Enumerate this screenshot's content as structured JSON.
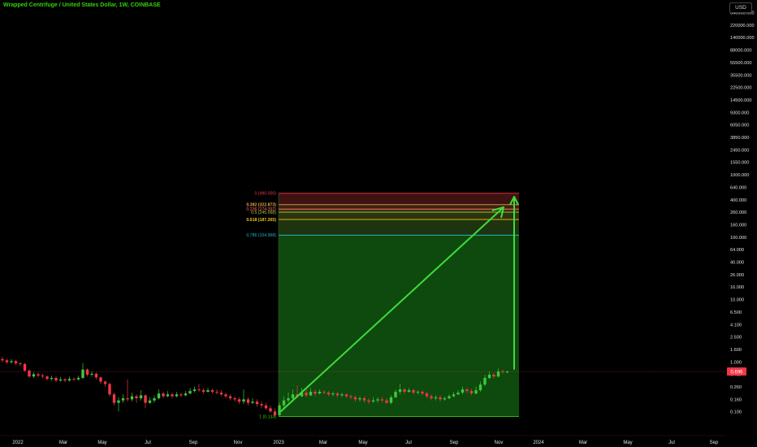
{
  "header": {
    "title": "Wrapped Centrifuge / United States Dollar, 1W, COINBASE",
    "currency": "USD"
  },
  "colors": {
    "background": "#000000",
    "title": "#35d10a",
    "up_candle": "#3ec93a",
    "down_candle": "#f23645",
    "axis_text": "#e0e0e0",
    "price_line": "#f23645",
    "arrow": "#3ddc3d",
    "target_zone": "#0f4d0f"
  },
  "chart_data": {
    "type": "candlestick",
    "title": "Wrapped Centrifuge / United States Dollar, 1W, COINBASE",
    "y_scale": "log",
    "y_ticks": [
      "340000.000",
      "220000.000",
      "140000.000",
      "88000.000",
      "55500.000",
      "35500.000",
      "22500.000",
      "14500.000",
      "9300.000",
      "6050.000",
      "3850.000",
      "2450.000",
      "1550.000",
      "1000.000",
      "640.000",
      "400.000",
      "260.000",
      "160.000",
      "100.000",
      "64.000",
      "40.000",
      "26.000",
      "16.000",
      "10.000",
      "6.500",
      "4.100",
      "2.500",
      "1.600",
      "1.000",
      "0.410",
      "0.260",
      "0.160",
      "0.100"
    ],
    "x_ticks": [
      "2022",
      "Mar",
      "May",
      "Jul",
      "Sep",
      "Nov",
      "2023",
      "Mar",
      "May",
      "Jul",
      "Sep",
      "Nov",
      "2024",
      "Mar",
      "May",
      "Jul",
      "Sep"
    ],
    "last_price": {
      "label": "0.696",
      "value": 0.696
    },
    "fib_levels": [
      {
        "ratio": "0",
        "label": "0 (490.000)",
        "value": 490.0,
        "color": "#f23645"
      },
      {
        "ratio": "0.236",
        "label": "0.236 (274.392)",
        "value": 274.392,
        "color": "#ff6b6b"
      },
      {
        "ratio": "0.382",
        "label": "0.382 (322.873)",
        "value": 322.873,
        "color": "#e8a33d"
      },
      {
        "ratio": "0.5",
        "label": "0.5 (245.068)",
        "value": 245.068,
        "color": "#a8c93a"
      },
      {
        "ratio": "0.618",
        "label": "0.618 (187.265)",
        "value": 187.265,
        "color": "#f0c419"
      },
      {
        "ratio": "0.786",
        "label": "0.786 (104.968)",
        "value": 104.968,
        "color": "#22b5c9"
      },
      {
        "ratio": "1",
        "label": "1 (0.133)",
        "value": 0.133,
        "color": "#35d10a"
      }
    ],
    "candles": [
      [
        1.1,
        1.05,
        1.2,
        0.98
      ],
      [
        1.05,
        0.98,
        1.12,
        0.92
      ],
      [
        0.98,
        1.02,
        1.1,
        0.93
      ],
      [
        1.02,
        0.94,
        1.06,
        0.88
      ],
      [
        0.94,
        0.92,
        0.99,
        0.85
      ],
      [
        0.92,
        0.72,
        0.95,
        0.68
      ],
      [
        0.72,
        0.58,
        0.75,
        0.55
      ],
      [
        0.58,
        0.63,
        0.68,
        0.55
      ],
      [
        0.63,
        0.6,
        0.67,
        0.56
      ],
      [
        0.6,
        0.58,
        0.64,
        0.54
      ],
      [
        0.58,
        0.53,
        0.6,
        0.5
      ],
      [
        0.53,
        0.55,
        0.6,
        0.5
      ],
      [
        0.55,
        0.5,
        0.58,
        0.47
      ],
      [
        0.5,
        0.52,
        0.57,
        0.48
      ],
      [
        0.52,
        0.5,
        0.55,
        0.47
      ],
      [
        0.5,
        0.53,
        0.58,
        0.48
      ],
      [
        0.53,
        0.52,
        0.56,
        0.49
      ],
      [
        0.52,
        0.55,
        0.6,
        0.5
      ],
      [
        0.55,
        0.75,
        0.95,
        0.53
      ],
      [
        0.75,
        0.62,
        0.78,
        0.58
      ],
      [
        0.62,
        0.64,
        0.7,
        0.58
      ],
      [
        0.64,
        0.56,
        0.67,
        0.52
      ],
      [
        0.56,
        0.48,
        0.58,
        0.44
      ],
      [
        0.48,
        0.44,
        0.5,
        0.4
      ],
      [
        0.44,
        0.3,
        0.46,
        0.28
      ],
      [
        0.3,
        0.22,
        0.32,
        0.2
      ],
      [
        0.22,
        0.24,
        0.27,
        0.16
      ],
      [
        0.24,
        0.26,
        0.3,
        0.22
      ],
      [
        0.26,
        0.25,
        0.52,
        0.23
      ],
      [
        0.25,
        0.28,
        0.32,
        0.23
      ],
      [
        0.28,
        0.26,
        0.3,
        0.22
      ],
      [
        0.26,
        0.29,
        0.35,
        0.24
      ],
      [
        0.29,
        0.22,
        0.3,
        0.18
      ],
      [
        0.22,
        0.24,
        0.27,
        0.21
      ],
      [
        0.24,
        0.26,
        0.29,
        0.22
      ],
      [
        0.26,
        0.31,
        0.36,
        0.25
      ],
      [
        0.31,
        0.28,
        0.33,
        0.26
      ],
      [
        0.28,
        0.3,
        0.34,
        0.27
      ],
      [
        0.3,
        0.28,
        0.32,
        0.26
      ],
      [
        0.28,
        0.3,
        0.33,
        0.27
      ],
      [
        0.3,
        0.29,
        0.32,
        0.27
      ],
      [
        0.29,
        0.31,
        0.34,
        0.28
      ],
      [
        0.31,
        0.34,
        0.38,
        0.3
      ],
      [
        0.34,
        0.36,
        0.4,
        0.32
      ],
      [
        0.36,
        0.35,
        0.44,
        0.33
      ],
      [
        0.35,
        0.33,
        0.38,
        0.31
      ],
      [
        0.33,
        0.35,
        0.38,
        0.32
      ],
      [
        0.35,
        0.33,
        0.37,
        0.31
      ],
      [
        0.33,
        0.32,
        0.36,
        0.3
      ],
      [
        0.32,
        0.3,
        0.35,
        0.28
      ],
      [
        0.3,
        0.28,
        0.32,
        0.26
      ],
      [
        0.28,
        0.26,
        0.3,
        0.24
      ],
      [
        0.26,
        0.25,
        0.28,
        0.23
      ],
      [
        0.25,
        0.23,
        0.27,
        0.21
      ],
      [
        0.23,
        0.25,
        0.36,
        0.21
      ],
      [
        0.25,
        0.22,
        0.27,
        0.2
      ],
      [
        0.22,
        0.23,
        0.26,
        0.21
      ],
      [
        0.23,
        0.21,
        0.25,
        0.19
      ],
      [
        0.21,
        0.2,
        0.23,
        0.18
      ],
      [
        0.2,
        0.18,
        0.22,
        0.17
      ],
      [
        0.18,
        0.16,
        0.2,
        0.15
      ],
      [
        0.16,
        0.14,
        0.18,
        0.133
      ],
      [
        0.14,
        0.2,
        0.22,
        0.135
      ],
      [
        0.2,
        0.24,
        0.28,
        0.18
      ],
      [
        0.24,
        0.26,
        0.32,
        0.22
      ],
      [
        0.26,
        0.3,
        0.36,
        0.24
      ],
      [
        0.3,
        0.28,
        0.42,
        0.26
      ],
      [
        0.28,
        0.32,
        0.38,
        0.27
      ],
      [
        0.32,
        0.29,
        0.36,
        0.27
      ],
      [
        0.29,
        0.33,
        0.38,
        0.28
      ],
      [
        0.33,
        0.31,
        0.36,
        0.28
      ],
      [
        0.31,
        0.33,
        0.36,
        0.3
      ],
      [
        0.33,
        0.32,
        0.35,
        0.3
      ],
      [
        0.32,
        0.3,
        0.34,
        0.28
      ],
      [
        0.3,
        0.31,
        0.33,
        0.28
      ],
      [
        0.31,
        0.29,
        0.33,
        0.27
      ],
      [
        0.29,
        0.3,
        0.32,
        0.27
      ],
      [
        0.3,
        0.28,
        0.31,
        0.26
      ],
      [
        0.28,
        0.27,
        0.3,
        0.25
      ],
      [
        0.27,
        0.25,
        0.29,
        0.23
      ],
      [
        0.25,
        0.26,
        0.28,
        0.23
      ],
      [
        0.26,
        0.24,
        0.28,
        0.22
      ],
      [
        0.24,
        0.23,
        0.26,
        0.21
      ],
      [
        0.23,
        0.24,
        0.27,
        0.22
      ],
      [
        0.24,
        0.25,
        0.27,
        0.22
      ],
      [
        0.25,
        0.24,
        0.27,
        0.22
      ],
      [
        0.24,
        0.22,
        0.26,
        0.21
      ],
      [
        0.22,
        0.27,
        0.29,
        0.21
      ],
      [
        0.27,
        0.33,
        0.36,
        0.26
      ],
      [
        0.33,
        0.36,
        0.44,
        0.3
      ],
      [
        0.36,
        0.33,
        0.38,
        0.3
      ],
      [
        0.33,
        0.35,
        0.38,
        0.32
      ],
      [
        0.35,
        0.32,
        0.37,
        0.3
      ],
      [
        0.32,
        0.33,
        0.35,
        0.3
      ],
      [
        0.33,
        0.31,
        0.35,
        0.29
      ],
      [
        0.31,
        0.28,
        0.33,
        0.26
      ],
      [
        0.28,
        0.26,
        0.3,
        0.24
      ],
      [
        0.26,
        0.27,
        0.29,
        0.24
      ],
      [
        0.27,
        0.25,
        0.29,
        0.23
      ],
      [
        0.25,
        0.26,
        0.28,
        0.24
      ],
      [
        0.26,
        0.28,
        0.3,
        0.25
      ],
      [
        0.28,
        0.3,
        0.33,
        0.27
      ],
      [
        0.3,
        0.32,
        0.35,
        0.29
      ],
      [
        0.32,
        0.36,
        0.4,
        0.3
      ],
      [
        0.36,
        0.34,
        0.38,
        0.31
      ],
      [
        0.34,
        0.31,
        0.37,
        0.29
      ],
      [
        0.31,
        0.35,
        0.4,
        0.3
      ],
      [
        0.35,
        0.43,
        0.48,
        0.33
      ],
      [
        0.43,
        0.55,
        0.62,
        0.41
      ],
      [
        0.55,
        0.62,
        0.7,
        0.52
      ],
      [
        0.62,
        0.58,
        0.66,
        0.54
      ],
      [
        0.58,
        0.7,
        0.78,
        0.56
      ],
      [
        0.7,
        0.68,
        0.75,
        0.64
      ],
      [
        0.68,
        0.696,
        0.72,
        0.65
      ]
    ]
  }
}
